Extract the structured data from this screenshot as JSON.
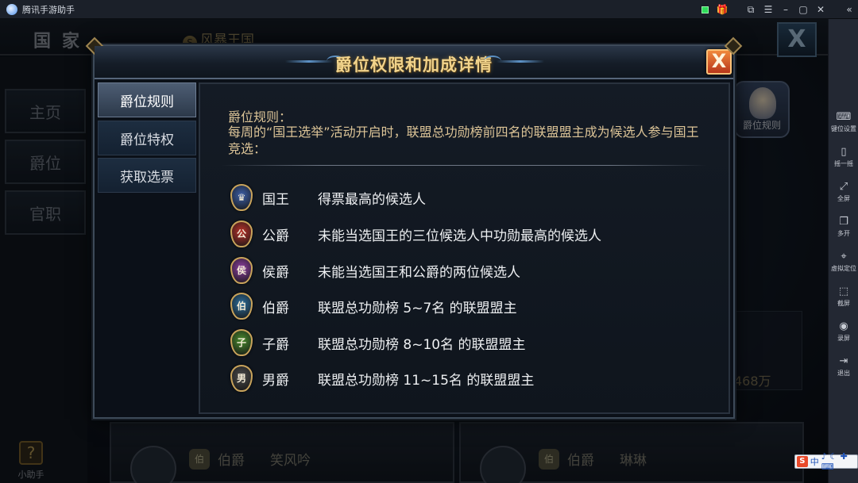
{
  "emulator": {
    "title": "腾讯手游助手",
    "titlebar_icons": [
      "app-logo-icon",
      "green-status-icon",
      "gift-icon",
      "screenshot-icon",
      "menu-icon",
      "minimize-icon",
      "maximize-icon",
      "close-icon",
      "collapse-icon"
    ],
    "sidebar": [
      {
        "label": "键位设置",
        "icon": "keyboard-icon",
        "glyph": "⌨"
      },
      {
        "label": "摇一摇",
        "icon": "shake-icon",
        "glyph": "▯"
      },
      {
        "label": "全屏",
        "icon": "fullscreen-icon",
        "glyph": "⤢"
      },
      {
        "label": "多开",
        "icon": "multi-window-icon",
        "glyph": "❐"
      },
      {
        "label": "虚拟定位",
        "icon": "location-icon",
        "glyph": "⌖"
      },
      {
        "label": "截屏",
        "icon": "capture-icon",
        "glyph": "⬚"
      },
      {
        "label": "录屏",
        "icon": "record-icon",
        "glyph": "◉"
      },
      {
        "label": "退出",
        "icon": "exit-icon",
        "glyph": "⇥"
      }
    ],
    "ime": {
      "lang": "中",
      "extra": "♪ ☾ ✚ ⌨"
    }
  },
  "game": {
    "header": {
      "country": "国家",
      "storm": "风暴王国",
      "storm_icon": "S"
    },
    "left_nav": [
      "主页",
      "爵位",
      "官职"
    ],
    "helper": "小助手",
    "avatar_label": "爵位规则",
    "gold_partial": "468万",
    "bottom_cards": [
      {
        "rank_badge": "伯",
        "rank": "伯爵",
        "name": "笑风吟"
      },
      {
        "rank_badge": "伯",
        "rank": "伯爵",
        "name": "琳琳"
      }
    ],
    "bg_close": "X"
  },
  "dialog": {
    "title": "爵位权限和加成详情",
    "close": "X",
    "tabs": [
      {
        "label": "爵位规则",
        "active": true
      },
      {
        "label": "爵位特权",
        "active": false
      },
      {
        "label": "获取选票",
        "active": false
      }
    ],
    "rules_title": "爵位规则：",
    "rules_desc": "每周的“国王选举”活动开启时，联盟总功勋榜前四名的联盟盟主成为候选人参与国王竞选：",
    "ranks": [
      {
        "badge": "♛",
        "name": "国王",
        "desc": "得票最高的候选人",
        "color": "#3d5fa8"
      },
      {
        "badge": "公",
        "name": "公爵",
        "desc": "未能当选国王的三位候选人中功勋最高的候选人",
        "color": "#b8332a"
      },
      {
        "badge": "侯",
        "name": "侯爵",
        "desc": "未能当选国王和公爵的两位候选人",
        "color": "#8f3fa3"
      },
      {
        "badge": "伯",
        "name": "伯爵",
        "desc": "联盟总功勋榜 5~7名 的联盟盟主",
        "color": "#2d6f9e"
      },
      {
        "badge": "子",
        "name": "子爵",
        "desc": "联盟总功勋榜 8~10名 的联盟盟主",
        "color": "#4a8c2e"
      },
      {
        "badge": "男",
        "name": "男爵",
        "desc": "联盟总功勋榜 11~15名 的联盟盟主",
        "color": "#4b4b4b"
      }
    ]
  }
}
